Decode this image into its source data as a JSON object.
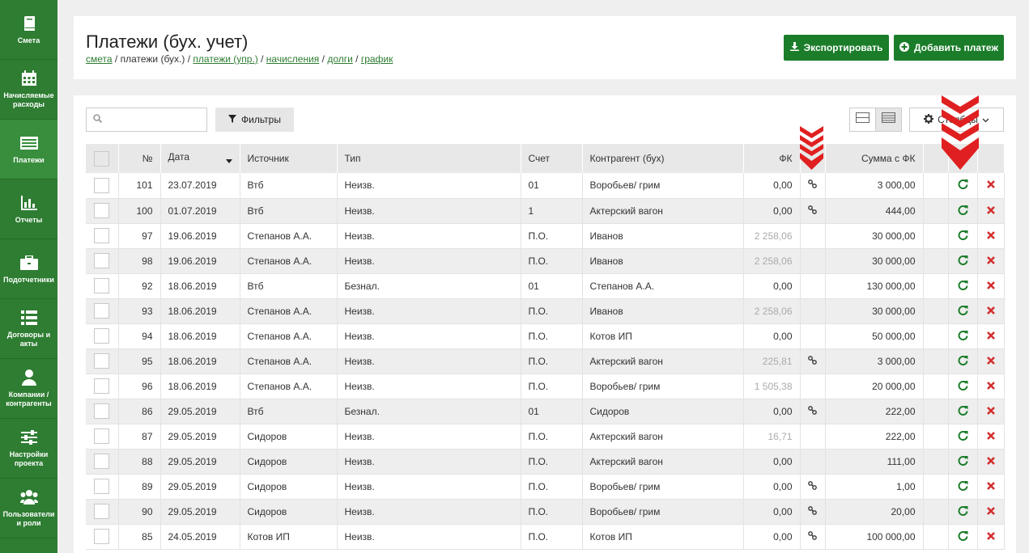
{
  "sidebar": {
    "items": [
      {
        "label": "Смета",
        "icon": "book-icon"
      },
      {
        "label": "Начисляемые расходы",
        "icon": "calendar-icon"
      },
      {
        "label": "Платежи",
        "icon": "payments-icon"
      },
      {
        "label": "Отчеты",
        "icon": "bar-chart-icon"
      },
      {
        "label": "Подотчетники",
        "icon": "briefcase-icon"
      },
      {
        "label": "Договоры и акты",
        "icon": "list-icon"
      },
      {
        "label": "Компании / контрагенты",
        "icon": "user-icon"
      },
      {
        "label": "Настройки проекта",
        "icon": "sliders-icon"
      },
      {
        "label": "Пользователи и роли",
        "icon": "users-icon"
      }
    ]
  },
  "header": {
    "title": "Платежи (бух. учет)",
    "breadcrumb": {
      "smeta": "смета",
      "sep": " / ",
      "current": "платежи (бух.)",
      "payments_upr": "платежи (упр.)",
      "accruals": "начисления",
      "debts": "долги",
      "schedule": "график"
    },
    "export_label": "Экспортировать",
    "add_label": "Добавить платеж"
  },
  "toolbar": {
    "search_placeholder": "",
    "filters_label": "Фильтры",
    "settings_label": "Столбцы"
  },
  "table": {
    "columns": [
      "№",
      "Дата",
      "Источник",
      "Тип",
      "Счет",
      "Контрагент (бух)",
      "ФК",
      "Сумма с ФК"
    ],
    "rows": [
      {
        "num": "101",
        "date": "23.07.2019",
        "source": "Втб",
        "type": "Неизв.",
        "account": "01",
        "counterparty": "Воробьев/ грим",
        "fk": "0,00",
        "fk_muted": false,
        "link": true,
        "sum": "3 000,00"
      },
      {
        "num": "100",
        "date": "01.07.2019",
        "source": "Втб",
        "type": "Неизв.",
        "account": "1",
        "counterparty": "Актерский вагон",
        "fk": "0,00",
        "fk_muted": false,
        "link": true,
        "sum": "444,00"
      },
      {
        "num": "97",
        "date": "19.06.2019",
        "source": "Степанов А.А.",
        "type": "Неизв.",
        "account": "П.О.",
        "counterparty": "Иванов",
        "fk": "2 258,06",
        "fk_muted": true,
        "link": false,
        "sum": "30 000,00"
      },
      {
        "num": "98",
        "date": "19.06.2019",
        "source": "Степанов А.А.",
        "type": "Неизв.",
        "account": "П.О.",
        "counterparty": "Иванов",
        "fk": "2 258,06",
        "fk_muted": true,
        "link": false,
        "sum": "30 000,00"
      },
      {
        "num": "92",
        "date": "18.06.2019",
        "source": "Втб",
        "type": "Безнал.",
        "account": "01",
        "counterparty": "Степанов А.А.",
        "fk": "0,00",
        "fk_muted": false,
        "link": false,
        "sum": "130 000,00"
      },
      {
        "num": "93",
        "date": "18.06.2019",
        "source": "Степанов А.А.",
        "type": "Неизв.",
        "account": "П.О.",
        "counterparty": "Иванов",
        "fk": "2 258,06",
        "fk_muted": true,
        "link": false,
        "sum": "30 000,00"
      },
      {
        "num": "94",
        "date": "18.06.2019",
        "source": "Степанов А.А.",
        "type": "Неизв.",
        "account": "П.О.",
        "counterparty": "Котов ИП",
        "fk": "0,00",
        "fk_muted": false,
        "link": false,
        "sum": "50 000,00"
      },
      {
        "num": "95",
        "date": "18.06.2019",
        "source": "Степанов А.А.",
        "type": "Неизв.",
        "account": "П.О.",
        "counterparty": "Актерский вагон",
        "fk": "225,81",
        "fk_muted": true,
        "link": true,
        "sum": "3 000,00"
      },
      {
        "num": "96",
        "date": "18.06.2019",
        "source": "Степанов А.А.",
        "type": "Неизв.",
        "account": "П.О.",
        "counterparty": "Воробьев/ грим",
        "fk": "1 505,38",
        "fk_muted": true,
        "link": false,
        "sum": "20 000,00"
      },
      {
        "num": "86",
        "date": "29.05.2019",
        "source": "Втб",
        "type": "Безнал.",
        "account": "01",
        "counterparty": "Сидоров",
        "fk": "0,00",
        "fk_muted": false,
        "link": true,
        "sum": "222,00"
      },
      {
        "num": "87",
        "date": "29.05.2019",
        "source": "Сидоров",
        "type": "Неизв.",
        "account": "П.О.",
        "counterparty": "Актерский вагон",
        "fk": "16,71",
        "fk_muted": true,
        "link": false,
        "sum": "222,00"
      },
      {
        "num": "88",
        "date": "29.05.2019",
        "source": "Сидоров",
        "type": "Неизв.",
        "account": "П.О.",
        "counterparty": "Актерский вагон",
        "fk": "0,00",
        "fk_muted": false,
        "link": false,
        "sum": "111,00"
      },
      {
        "num": "89",
        "date": "29.05.2019",
        "source": "Сидоров",
        "type": "Неизв.",
        "account": "П.О.",
        "counterparty": "Воробьев/ грим",
        "fk": "0,00",
        "fk_muted": false,
        "link": true,
        "sum": "1,00"
      },
      {
        "num": "90",
        "date": "29.05.2019",
        "source": "Сидоров",
        "type": "Неизв.",
        "account": "П.О.",
        "counterparty": "Воробьев/ грим",
        "fk": "0,00",
        "fk_muted": false,
        "link": true,
        "sum": "20,00"
      },
      {
        "num": "85",
        "date": "24.05.2019",
        "source": "Котов ИП",
        "type": "Неизв.",
        "account": "П.О.",
        "counterparty": "Котов ИП",
        "fk": "0,00",
        "fk_muted": false,
        "link": true,
        "sum": "100 000,00"
      }
    ]
  },
  "colors": {
    "brand": "#2e7d32",
    "button": "#1b7d2a",
    "delete": "#d32f2f",
    "arrow": "#e02020"
  }
}
